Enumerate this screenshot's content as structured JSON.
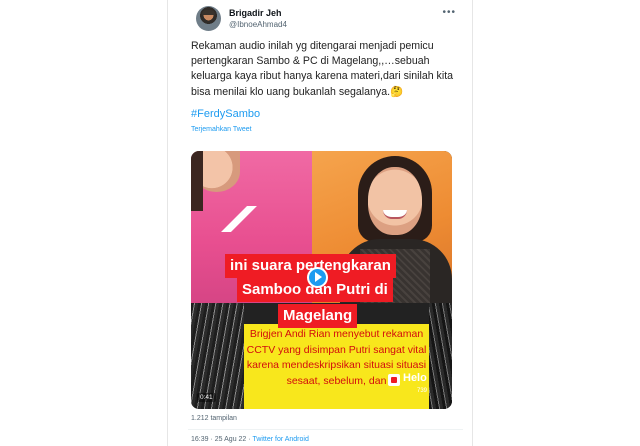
{
  "tweet": {
    "display_name": "Brigadir Jeh",
    "handle": "@IbnoeAhmad4",
    "more_icon": "more-horizontal-icon",
    "text": "Rekaman audio inilah yg ditengarai menjadi pemicu pertengkaran Sambo & PC di Magelang,,…sebuah keluarga kaya ribut hanya karena materi,dari sinilah kita bisa menilai klo uang bukanlah segalanya.🤔",
    "hashtag": "#FerdySambo",
    "translate_label": "Terjemahkan Tweet",
    "views": "1.212 tampilan",
    "time": "16:39",
    "date": "25 Agu 22",
    "separator": "·",
    "source": "Twitter for Android"
  },
  "video": {
    "caption_lines": [
      "ini suara pertengkaran",
      "Samboo dan Putri di",
      "Magelang"
    ],
    "subtitle": "Brigjen Andi Rian menyebut rekaman CCTV yang disimpan Putri sangat vital karena mendeskripsikan situasi situasi sesaat, sebelum, dan",
    "watermark": "Helo",
    "watermark_id": "739",
    "duration": "0:41"
  },
  "colors": {
    "link": "#1d9bf0",
    "caption_bg": "#ef1c24",
    "subtitle_bg": "#f8e71c",
    "subtitle_text": "#d20d0d"
  }
}
